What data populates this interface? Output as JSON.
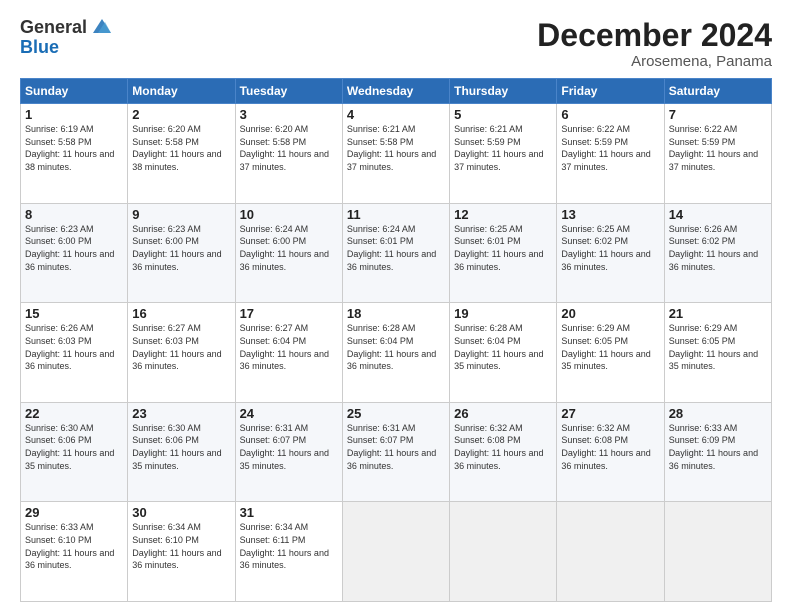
{
  "logo": {
    "general": "General",
    "blue": "Blue"
  },
  "title": "December 2024",
  "location": "Arosemena, Panama",
  "days_of_week": [
    "Sunday",
    "Monday",
    "Tuesday",
    "Wednesday",
    "Thursday",
    "Friday",
    "Saturday"
  ],
  "weeks": [
    [
      {
        "day": "1",
        "sunrise": "Sunrise: 6:19 AM",
        "sunset": "Sunset: 5:58 PM",
        "daylight": "Daylight: 11 hours and 38 minutes."
      },
      {
        "day": "2",
        "sunrise": "Sunrise: 6:20 AM",
        "sunset": "Sunset: 5:58 PM",
        "daylight": "Daylight: 11 hours and 38 minutes."
      },
      {
        "day": "3",
        "sunrise": "Sunrise: 6:20 AM",
        "sunset": "Sunset: 5:58 PM",
        "daylight": "Daylight: 11 hours and 37 minutes."
      },
      {
        "day": "4",
        "sunrise": "Sunrise: 6:21 AM",
        "sunset": "Sunset: 5:58 PM",
        "daylight": "Daylight: 11 hours and 37 minutes."
      },
      {
        "day": "5",
        "sunrise": "Sunrise: 6:21 AM",
        "sunset": "Sunset: 5:59 PM",
        "daylight": "Daylight: 11 hours and 37 minutes."
      },
      {
        "day": "6",
        "sunrise": "Sunrise: 6:22 AM",
        "sunset": "Sunset: 5:59 PM",
        "daylight": "Daylight: 11 hours and 37 minutes."
      },
      {
        "day": "7",
        "sunrise": "Sunrise: 6:22 AM",
        "sunset": "Sunset: 5:59 PM",
        "daylight": "Daylight: 11 hours and 37 minutes."
      }
    ],
    [
      {
        "day": "8",
        "sunrise": "Sunrise: 6:23 AM",
        "sunset": "Sunset: 6:00 PM",
        "daylight": "Daylight: 11 hours and 36 minutes."
      },
      {
        "day": "9",
        "sunrise": "Sunrise: 6:23 AM",
        "sunset": "Sunset: 6:00 PM",
        "daylight": "Daylight: 11 hours and 36 minutes."
      },
      {
        "day": "10",
        "sunrise": "Sunrise: 6:24 AM",
        "sunset": "Sunset: 6:00 PM",
        "daylight": "Daylight: 11 hours and 36 minutes."
      },
      {
        "day": "11",
        "sunrise": "Sunrise: 6:24 AM",
        "sunset": "Sunset: 6:01 PM",
        "daylight": "Daylight: 11 hours and 36 minutes."
      },
      {
        "day": "12",
        "sunrise": "Sunrise: 6:25 AM",
        "sunset": "Sunset: 6:01 PM",
        "daylight": "Daylight: 11 hours and 36 minutes."
      },
      {
        "day": "13",
        "sunrise": "Sunrise: 6:25 AM",
        "sunset": "Sunset: 6:02 PM",
        "daylight": "Daylight: 11 hours and 36 minutes."
      },
      {
        "day": "14",
        "sunrise": "Sunrise: 6:26 AM",
        "sunset": "Sunset: 6:02 PM",
        "daylight": "Daylight: 11 hours and 36 minutes."
      }
    ],
    [
      {
        "day": "15",
        "sunrise": "Sunrise: 6:26 AM",
        "sunset": "Sunset: 6:03 PM",
        "daylight": "Daylight: 11 hours and 36 minutes."
      },
      {
        "day": "16",
        "sunrise": "Sunrise: 6:27 AM",
        "sunset": "Sunset: 6:03 PM",
        "daylight": "Daylight: 11 hours and 36 minutes."
      },
      {
        "day": "17",
        "sunrise": "Sunrise: 6:27 AM",
        "sunset": "Sunset: 6:04 PM",
        "daylight": "Daylight: 11 hours and 36 minutes."
      },
      {
        "day": "18",
        "sunrise": "Sunrise: 6:28 AM",
        "sunset": "Sunset: 6:04 PM",
        "daylight": "Daylight: 11 hours and 36 minutes."
      },
      {
        "day": "19",
        "sunrise": "Sunrise: 6:28 AM",
        "sunset": "Sunset: 6:04 PM",
        "daylight": "Daylight: 11 hours and 35 minutes."
      },
      {
        "day": "20",
        "sunrise": "Sunrise: 6:29 AM",
        "sunset": "Sunset: 6:05 PM",
        "daylight": "Daylight: 11 hours and 35 minutes."
      },
      {
        "day": "21",
        "sunrise": "Sunrise: 6:29 AM",
        "sunset": "Sunset: 6:05 PM",
        "daylight": "Daylight: 11 hours and 35 minutes."
      }
    ],
    [
      {
        "day": "22",
        "sunrise": "Sunrise: 6:30 AM",
        "sunset": "Sunset: 6:06 PM",
        "daylight": "Daylight: 11 hours and 35 minutes."
      },
      {
        "day": "23",
        "sunrise": "Sunrise: 6:30 AM",
        "sunset": "Sunset: 6:06 PM",
        "daylight": "Daylight: 11 hours and 35 minutes."
      },
      {
        "day": "24",
        "sunrise": "Sunrise: 6:31 AM",
        "sunset": "Sunset: 6:07 PM",
        "daylight": "Daylight: 11 hours and 35 minutes."
      },
      {
        "day": "25",
        "sunrise": "Sunrise: 6:31 AM",
        "sunset": "Sunset: 6:07 PM",
        "daylight": "Daylight: 11 hours and 36 minutes."
      },
      {
        "day": "26",
        "sunrise": "Sunrise: 6:32 AM",
        "sunset": "Sunset: 6:08 PM",
        "daylight": "Daylight: 11 hours and 36 minutes."
      },
      {
        "day": "27",
        "sunrise": "Sunrise: 6:32 AM",
        "sunset": "Sunset: 6:08 PM",
        "daylight": "Daylight: 11 hours and 36 minutes."
      },
      {
        "day": "28",
        "sunrise": "Sunrise: 6:33 AM",
        "sunset": "Sunset: 6:09 PM",
        "daylight": "Daylight: 11 hours and 36 minutes."
      }
    ],
    [
      {
        "day": "29",
        "sunrise": "Sunrise: 6:33 AM",
        "sunset": "Sunset: 6:10 PM",
        "daylight": "Daylight: 11 hours and 36 minutes."
      },
      {
        "day": "30",
        "sunrise": "Sunrise: 6:34 AM",
        "sunset": "Sunset: 6:10 PM",
        "daylight": "Daylight: 11 hours and 36 minutes."
      },
      {
        "day": "31",
        "sunrise": "Sunrise: 6:34 AM",
        "sunset": "Sunset: 6:11 PM",
        "daylight": "Daylight: 11 hours and 36 minutes."
      },
      null,
      null,
      null,
      null
    ]
  ]
}
